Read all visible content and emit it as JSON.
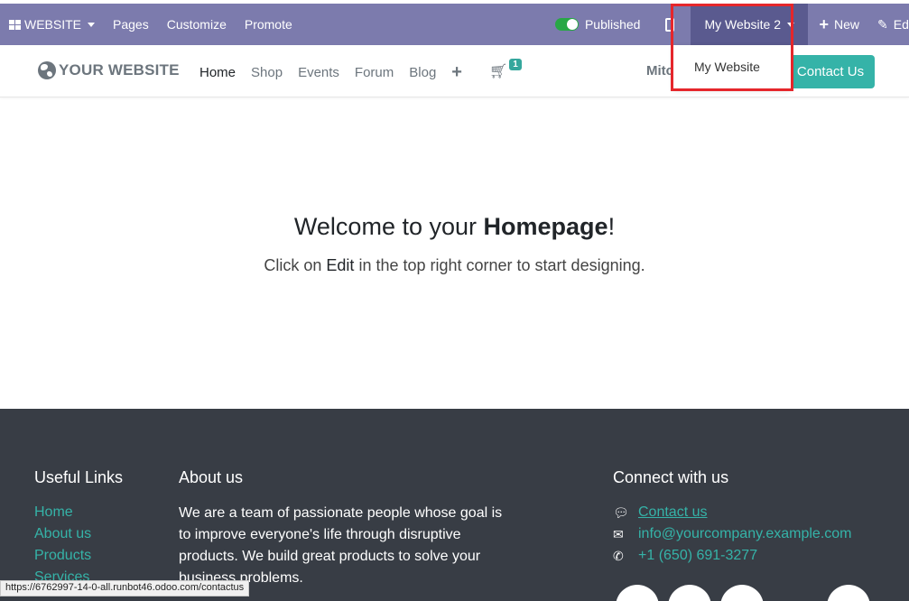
{
  "admin_bar": {
    "website_label": "WEBSITE",
    "pages": "Pages",
    "customize": "Customize",
    "promote": "Promote",
    "published": "Published",
    "site_switcher": "My Website 2",
    "new": "New",
    "edit": "Edit"
  },
  "dropdown": {
    "option": "My Website"
  },
  "navbar": {
    "logo": "YOUR WEBSITE",
    "items": [
      "Home",
      "Shop",
      "Events",
      "Forum",
      "Blog"
    ],
    "cart_count": "1",
    "user": "Mitc",
    "contact_btn": "Contact Us"
  },
  "hero": {
    "title_pre": "Welcome to your ",
    "title_bold": "Homepage",
    "title_post": "!",
    "sub_pre": "Click on ",
    "sub_bold": "Edit",
    "sub_post": " in the top right corner to start designing."
  },
  "footer": {
    "useful_links_title": "Useful Links",
    "links": [
      "Home",
      "About us",
      "Products",
      "Services"
    ],
    "about_title": "About us",
    "about_text": "We are a team of passionate people whose goal is to improve everyone's life through disruptive products. We build great products to solve your business problems.",
    "connect_title": "Connect with us",
    "contact_link": "Contact us",
    "email": "info@yourcompany.example.com",
    "phone": "+1 (650) 691-3277"
  },
  "status_url": "https://6762997-14-0-all.runbot46.odoo.com/contactus",
  "colors": {
    "admin_bar": "#7c7bad",
    "accent": "#35b3a8",
    "footer": "#383d45",
    "highlight": "#e5262b"
  }
}
